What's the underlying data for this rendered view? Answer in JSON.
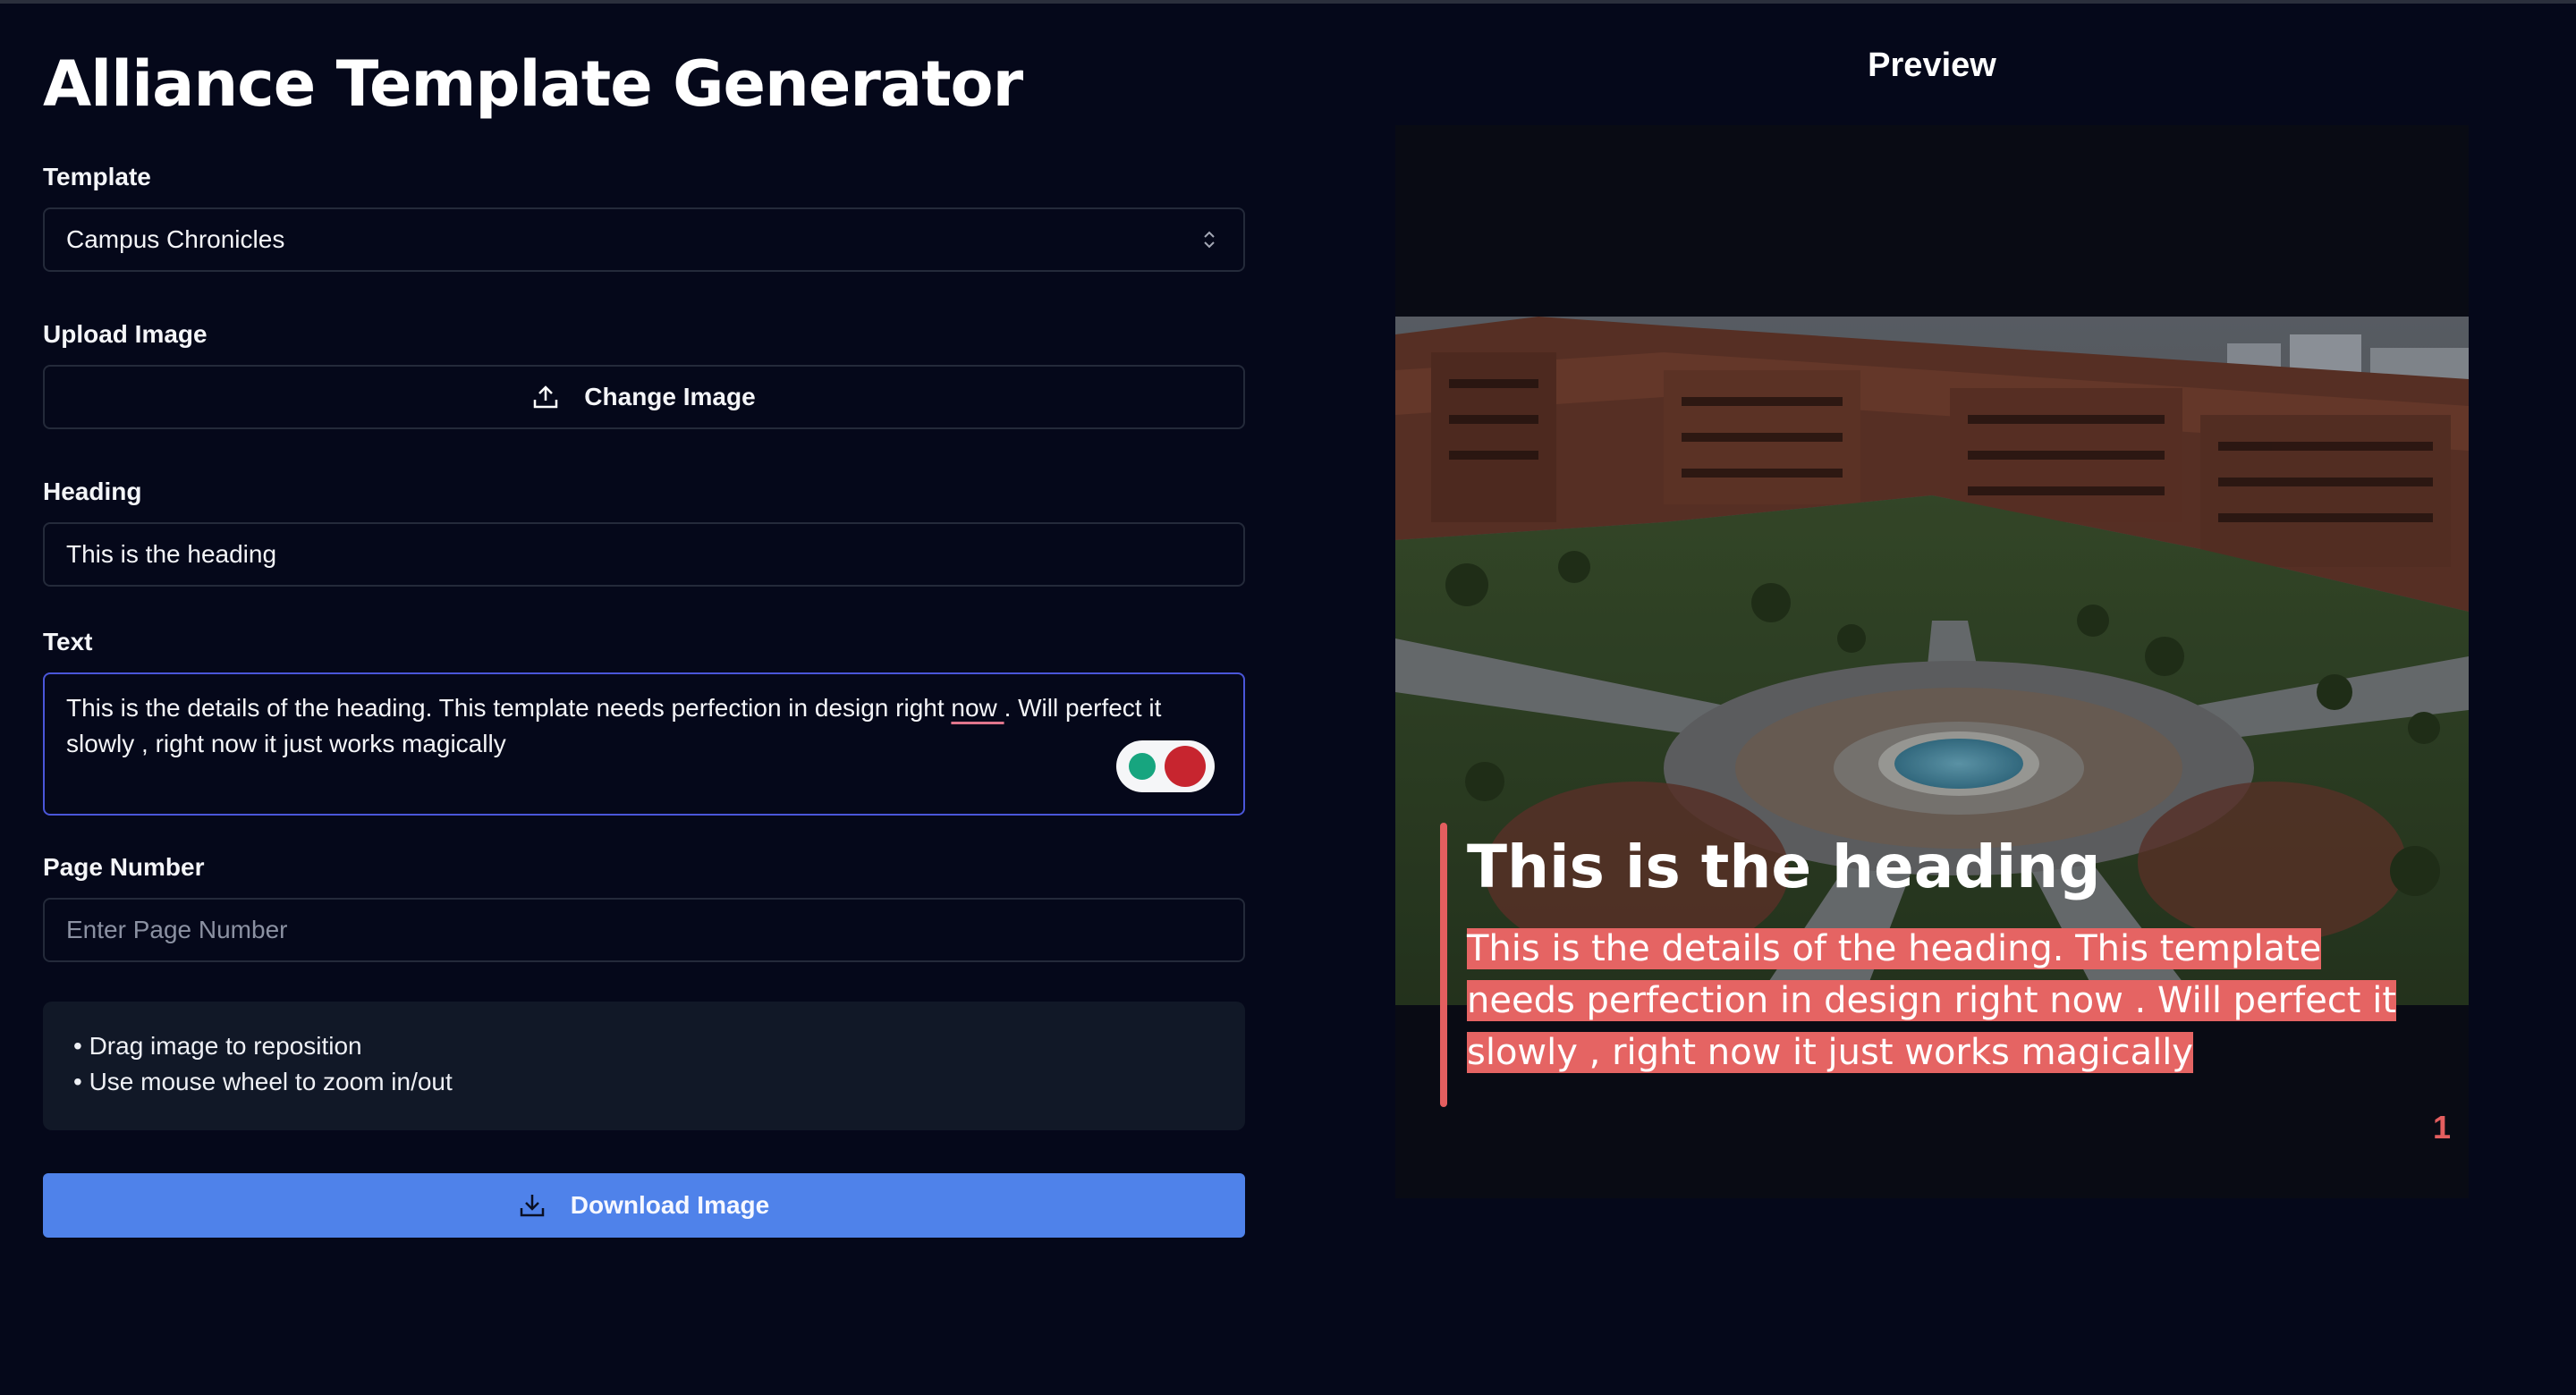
{
  "app": {
    "title": "Alliance Template Generator"
  },
  "form": {
    "template": {
      "label": "Template",
      "selected": "Campus Chronicles"
    },
    "upload": {
      "label": "Upload Image",
      "button_label": "Change Image"
    },
    "heading": {
      "label": "Heading",
      "value": "This is the heading"
    },
    "text": {
      "label": "Text",
      "value_before": "This is the details of the heading. This template needs perfection in design right ",
      "value_underlined": "now ",
      "value_after": ". Will perfect it slowly , right now it just works magically"
    },
    "page_number": {
      "label": "Page Number",
      "placeholder": "Enter Page Number"
    },
    "tips": [
      "• Drag image to reposition",
      "• Use mouse wheel to zoom in/out"
    ],
    "download_label": "Download Image"
  },
  "preview": {
    "title": "Preview",
    "heading": "This is the heading",
    "text": "This is the details of the heading. This template needs perfection in design right now . Will perfect it slowly , right now it just works magically",
    "page_number": "1"
  },
  "colors": {
    "background": "#05081a",
    "accent_blue": "#4f82ea",
    "accent_red": "#e45e5f",
    "focus_border": "#4a56d9"
  },
  "icons": {
    "upload": "upload-icon",
    "download": "download-icon",
    "select": "chevron-up-down-icon"
  }
}
